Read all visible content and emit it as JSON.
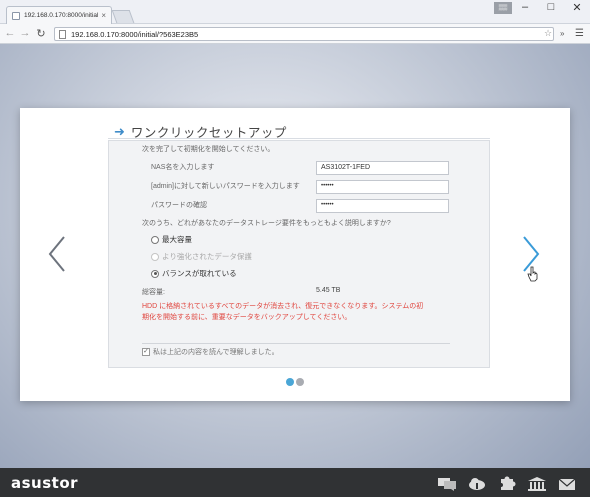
{
  "browser": {
    "tab_title": "192.168.0.170:8000/initial/",
    "url": "192.168.0.170:8000/initial/?563E23B5",
    "profile_badge": "▒▒"
  },
  "wizard": {
    "title": "ワンクリックセットアップ",
    "intro": "次を完了して初期化を開始してください。",
    "nas_name_label": "NAS名を入力します",
    "nas_name_value": "AS3102T-1FED",
    "admin_pw_label": "[admin]に対して新しいパスワードを入力します",
    "admin_pw_value": "••••••",
    "confirm_label": "パスワードの確認",
    "confirm_value": "••••••",
    "question": "次のうち、どれがあなたのデータストレージ要件をもっともよく説明しますか?",
    "options": [
      {
        "label": "最大容量",
        "selected": false,
        "disabled": false
      },
      {
        "label": "より強化されたデータ保護",
        "selected": false,
        "disabled": true
      },
      {
        "label": "バランスが取れている",
        "selected": true,
        "disabled": false
      }
    ],
    "capacity_label": "総容量:",
    "capacity_value": "5.45 TB",
    "warning_line1": "HDD に格納されているすべてのデータが消去され、復元できなくなります。システムの初",
    "warning_line2": "期化を開始する前に、重要なデータをバックアップしてください。",
    "agree_label": "私は上記の内容を読んで理解しました。",
    "agree_checked": true
  },
  "pagination": {
    "active": 1,
    "total": 2
  },
  "colors": {
    "accent": "#3f8cc9",
    "dot_active": "#4aa6d6",
    "dot_inactive": "#a9acb2",
    "warning": "#e0443d",
    "footer": "#303234"
  },
  "footer": {
    "logo": "asustor",
    "icons": [
      "chat-icon",
      "cloud-icon",
      "puzzle-icon",
      "library-icon",
      "mail-icon"
    ]
  }
}
